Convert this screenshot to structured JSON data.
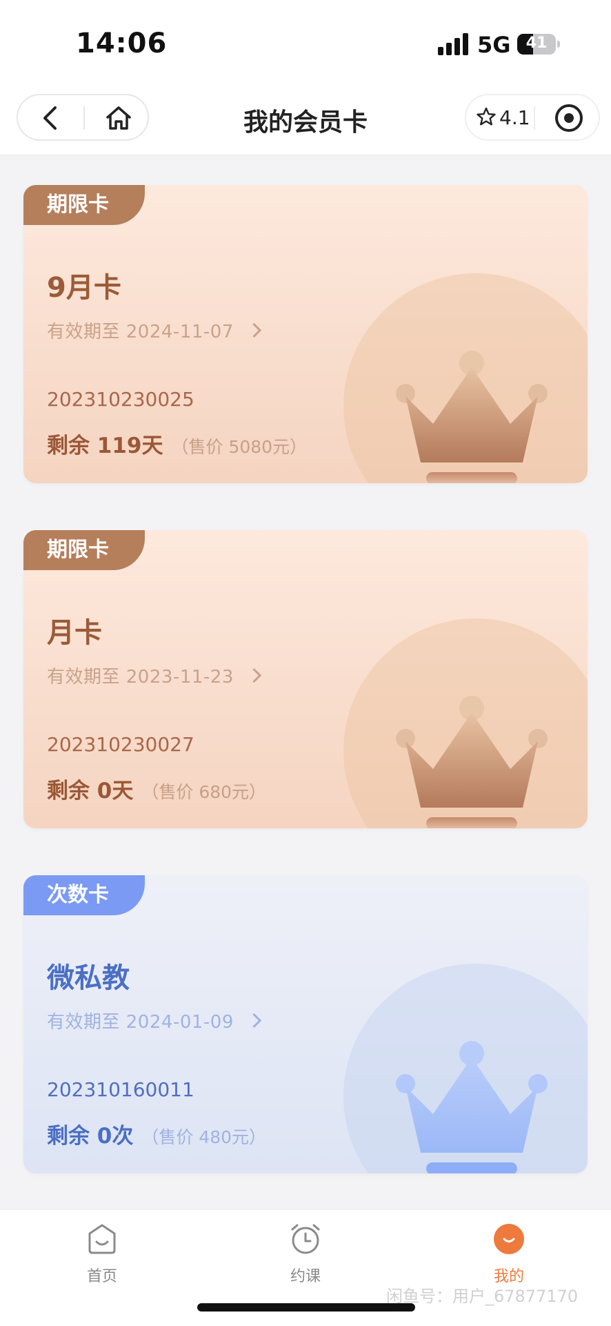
{
  "status_bar": {
    "time": "14:06",
    "network": "5G",
    "battery": "41",
    "battery_fraction": 0.41
  },
  "nav": {
    "title": "我的会员卡",
    "rating": "4.1"
  },
  "cards": [
    {
      "tag": "期限卡",
      "name": "9月卡",
      "validity": "有效期至 2024-11-07",
      "number": "202310230025",
      "remain": "剩余 119天",
      "price": "（售价 5080元）",
      "theme": "warm"
    },
    {
      "tag": "期限卡",
      "name": "月卡",
      "validity": "有效期至 2023-11-23",
      "number": "202310230027",
      "remain": "剩余 0天",
      "price": "（售价 680元）",
      "theme": "warm"
    },
    {
      "tag": "次数卡",
      "name": "微私教",
      "validity": "有效期至 2024-01-09",
      "number": "202310160011",
      "remain": "剩余 0次",
      "price": "（售价 480元）",
      "theme": "cool"
    }
  ],
  "tabs": [
    {
      "label": "首页",
      "icon": "home-face-icon"
    },
    {
      "label": "约课",
      "icon": "alarm-clock-icon"
    },
    {
      "label": "我的",
      "icon": "profile-face-icon"
    }
  ],
  "active_tab": "我的",
  "watermark": "闲鱼号：用户_67877170",
  "colors": {
    "accent": "#ee7a3d",
    "warm_tag": "#b57f5b",
    "cool_tag": "#7a9af3"
  }
}
